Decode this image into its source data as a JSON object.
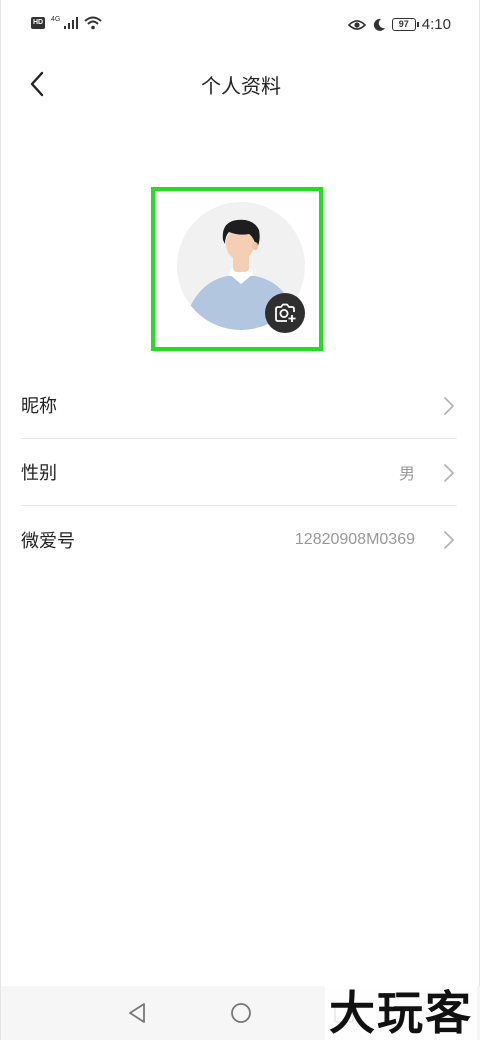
{
  "status_bar": {
    "hd": "HD",
    "network": "4G",
    "battery": "97",
    "time": "4:10"
  },
  "nav": {
    "title": "个人资料"
  },
  "profile": {
    "rows": [
      {
        "label": "昵称",
        "value": ""
      },
      {
        "label": "性别",
        "value": "男"
      },
      {
        "label": "微爱号",
        "value": "12820908M0369"
      }
    ]
  },
  "watermark": "大玩客",
  "icons": {
    "back": "chevron-left-icon",
    "camera": "camera-plus-icon",
    "chevron": "chevron-right-icon",
    "eye": "eye-icon",
    "moon": "moon-icon",
    "wifi": "wifi-icon",
    "signal": "signal-icon"
  },
  "colors": {
    "highlight": "#22dd22",
    "avatar_bg": "#f1f1f1",
    "shirt": "#b3c6e0",
    "camera_btn": "#2f2f2f"
  }
}
